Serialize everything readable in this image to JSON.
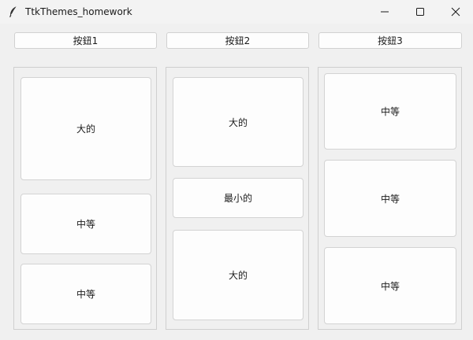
{
  "window": {
    "title": "TtkThemes_homework",
    "controls": {
      "minimize": "minimize-icon",
      "maximize": "maximize-icon",
      "close": "close-icon"
    }
  },
  "top_buttons": [
    "按鈕1",
    "按鈕2",
    "按鈕3"
  ],
  "panels": [
    {
      "items": [
        "大的",
        "中等",
        "中等"
      ]
    },
    {
      "items": [
        "大的",
        "最小的",
        "大的"
      ]
    },
    {
      "items": [
        "中等",
        "中等",
        "中等"
      ]
    }
  ]
}
